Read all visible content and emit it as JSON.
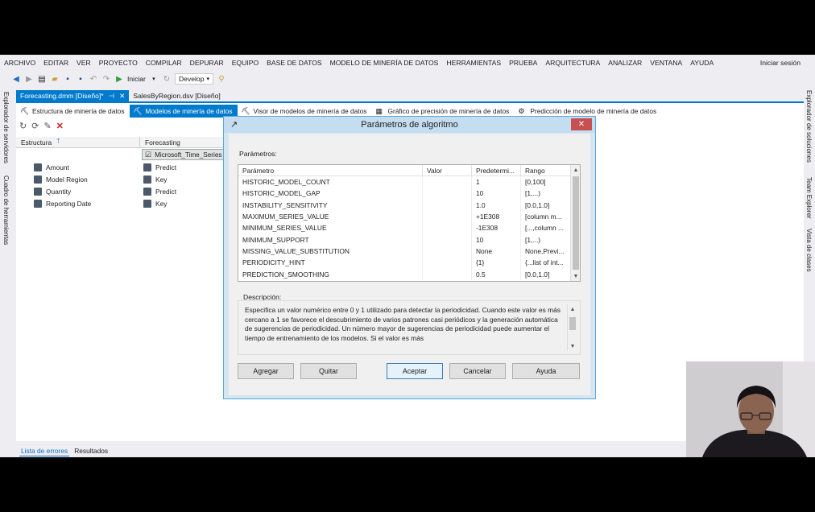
{
  "menu": [
    "ARCHIVO",
    "EDITAR",
    "VER",
    "PROYECTO",
    "COMPILAR",
    "DEPURAR",
    "EQUIPO",
    "BASE DE DATOS",
    "MODELO DE MINERÍA DE DATOS",
    "HERRAMIENTAS",
    "PRUEBA",
    "ARQUITECTURA",
    "ANALIZAR",
    "VENTANA",
    "AYUDA"
  ],
  "signin": "Iniciar sesión",
  "toolbar": {
    "start_label": "Iniciar",
    "config_value": "Develop"
  },
  "left_rail": [
    "Explorador de servidores",
    "Cuadro de herramientas"
  ],
  "right_rail": [
    "Explorador de soluciones",
    "Team Explorer",
    "Vista de clases"
  ],
  "doc_tabs": [
    {
      "label": "Forecasting.dmm [Diseño]*"
    },
    {
      "label": "SalesByRegion.dsv [Diseño]"
    }
  ],
  "design_tabs": [
    "Estructura de minería de datos",
    "Modelos de minería de datos",
    "Visor de modelos de minería de datos",
    "Gráfico de precisión de minería de datos",
    "Predicción de modelo de minería de datos"
  ],
  "structure": {
    "header": "Estructura",
    "model_header": "Forecasting",
    "model_name": "Microsoft_Time_Series",
    "columns": [
      {
        "name": "Amount",
        "usage": "Predict"
      },
      {
        "name": "Model Region",
        "usage": "Key"
      },
      {
        "name": "Quantity",
        "usage": "Predict"
      },
      {
        "name": "Reporting Date",
        "usage": "Key"
      }
    ]
  },
  "dialog": {
    "title": "Parámetros de algoritmo",
    "params_label": "Parámetros:",
    "headers": [
      "Parámetro",
      "Valor",
      "Predetermi...",
      "Rango"
    ],
    "rows": [
      [
        "HISTORIC_MODEL_COUNT",
        "",
        "1",
        "[0,100]"
      ],
      [
        "HISTORIC_MODEL_GAP",
        "",
        "10",
        "[1,...)"
      ],
      [
        "INSTABILITY_SENSITIVITY",
        "",
        "1.0",
        "[0.0,1.0]"
      ],
      [
        "MAXIMUM_SERIES_VALUE",
        "",
        "+1E308",
        "[column m..."
      ],
      [
        "MINIMUM_SERIES_VALUE",
        "",
        "-1E308",
        "[...,column ..."
      ],
      [
        "MINIMUM_SUPPORT",
        "",
        "10",
        "[1,...)"
      ],
      [
        "MISSING_VALUE_SUBSTITUTION",
        "",
        "None",
        "None,Previ..."
      ],
      [
        "PERIODICITY_HINT",
        "",
        "{1}",
        "{...list of int..."
      ],
      [
        "PREDICTION_SMOOTHING",
        "",
        "0.5",
        "[0.0,1.0]"
      ]
    ],
    "desc_label": "Descripción:",
    "description": "Especifica un valor numérico entre 0 y 1 utilizado para detectar la periodicidad. Cuando este valor es más cercano a 1 se favorece el descubrimiento de varios patrones casi periódicos y la generación automática de sugerencias de periodicidad. Un número mayor de sugerencias de periodicidad puede aumentar el tiempo de entrenamiento de los modelos. Si el valor es más",
    "buttons": {
      "add": "Agregar",
      "remove": "Quitar",
      "ok": "Aceptar",
      "cancel": "Cancelar",
      "help": "Ayuda"
    }
  },
  "bottom_tabs": [
    "Lista de errores",
    "Resultados"
  ],
  "colors": {
    "accent": "#007acc",
    "close": "#c75050"
  }
}
